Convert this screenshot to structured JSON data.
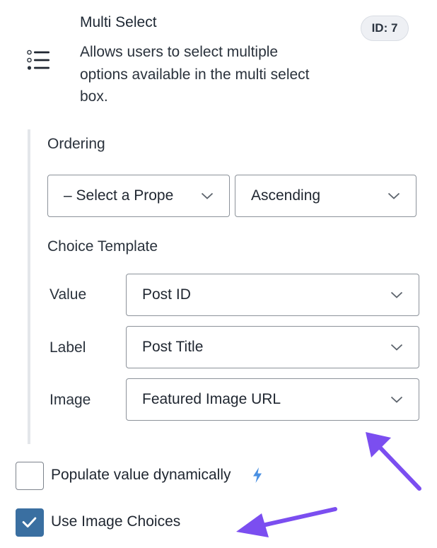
{
  "field": {
    "icon": "list-icon",
    "title": "Multi Select",
    "description": "Allows users to select multiple options available in the multi select box.",
    "id_badge": "ID: 7"
  },
  "ordering": {
    "label": "Ordering",
    "property_select": "– Select a Prope",
    "direction_select": "Ascending"
  },
  "choice_template": {
    "label": "Choice Template",
    "rows": [
      {
        "label": "Value",
        "selected": "Post ID"
      },
      {
        "label": "Label",
        "selected": "Post Title"
      },
      {
        "label": "Image",
        "selected": "Featured Image URL"
      }
    ]
  },
  "options": {
    "populate_dynamically": {
      "label": "Populate value dynamically",
      "checked": false,
      "icon": "bolt-icon"
    },
    "use_image_choices": {
      "label": "Use Image Choices",
      "checked": true,
      "icon": "check-icon"
    }
  },
  "colors": {
    "checkbox_checked": "#3a6fa1",
    "bolt": "#4a90e2",
    "annotation_arrow": "#7b4ef0"
  }
}
